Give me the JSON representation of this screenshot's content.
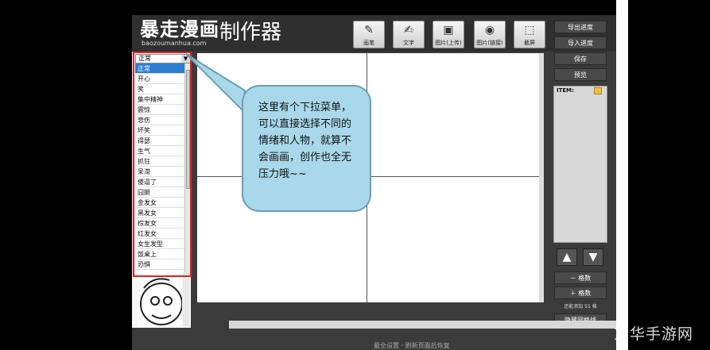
{
  "header": {
    "logo": "暴走漫画",
    "logo_sub": "baozoumanhua.com",
    "title": "制作器",
    "tools": [
      {
        "label": "画笔",
        "icon": "pen-icon"
      },
      {
        "label": "文字",
        "icon": "text-icon"
      },
      {
        "label": "图片(上传)",
        "icon": "camera-icon"
      },
      {
        "label": "图片(链接)",
        "icon": "globe-icon"
      },
      {
        "label": "截屏",
        "icon": "screenshot-icon"
      }
    ]
  },
  "right_panel": {
    "export": "导出进度",
    "import": "导入进度",
    "save": "保存",
    "preview": "预览",
    "item_label": "ITEM:",
    "up_icon": "arrow-up-icon",
    "down_icon": "arrow-down-icon",
    "minus_grid": "－ 格数",
    "plus_grid": "＋ 格数",
    "count_text": "还能添加 55 格",
    "hide_grid": "隐藏网格线"
  },
  "dropdown": {
    "selected": "正常",
    "items": [
      "正常",
      "开心",
      "笑",
      "集中精神",
      "震惊",
      "悲伤",
      "坏笑",
      "得瑟",
      "生气",
      "抓狂",
      "呆滞",
      "傻逼了",
      "囧腿",
      "金发女",
      "黑发女",
      "棕发女",
      "红发女",
      "女生发型",
      "饭桌上",
      "恐惧"
    ]
  },
  "callout": {
    "text": "这里有个下拉菜单，可以直接选择不同的情绪和人物，就算不会画画，创作也全无压力哦~~"
  },
  "watermark": "京华手游网",
  "footer_fragment": "最全设置  ·  刷新页面后恢复"
}
